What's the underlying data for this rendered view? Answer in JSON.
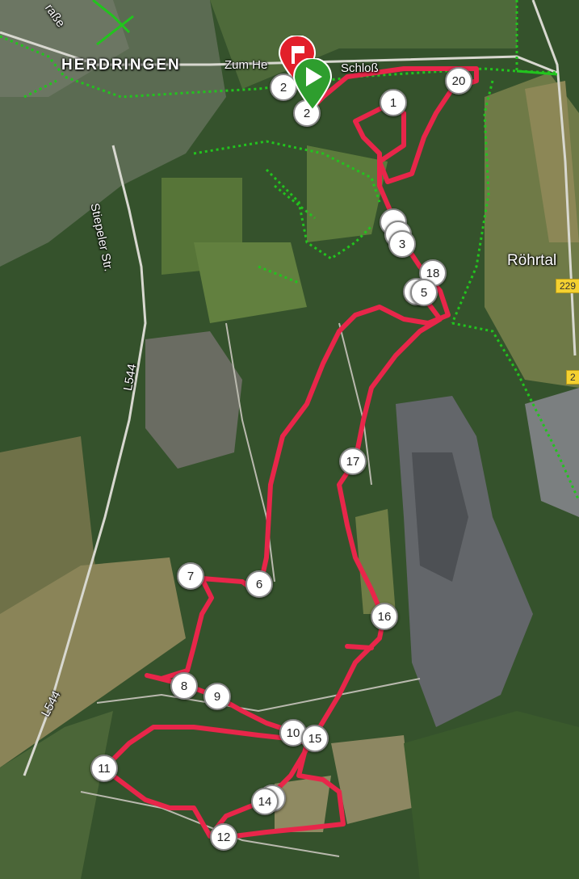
{
  "labels": {
    "town": "HERDRINGEN",
    "street_north": "Zum He",
    "street_east": "Schloß",
    "street_top": "raße",
    "road_west": "Stiepeler Str.",
    "route_a": "L544",
    "route_b": "L544",
    "region": "Röhrtal",
    "shield_1": "229",
    "shield_2": "2"
  },
  "waypoints": [
    {
      "n": "1"
    },
    {
      "n": "2"
    },
    {
      "n": "2"
    },
    {
      "n": "3"
    },
    {
      "n": "5"
    },
    {
      "n": "6"
    },
    {
      "n": "7"
    },
    {
      "n": "8"
    },
    {
      "n": "9"
    },
    {
      "n": "10"
    },
    {
      "n": "11"
    },
    {
      "n": "12"
    },
    {
      "n": "14"
    },
    {
      "n": "15"
    },
    {
      "n": "16"
    },
    {
      "n": "17"
    },
    {
      "n": "18"
    },
    {
      "n": "20"
    }
  ],
  "colors": {
    "route": "#e8264a",
    "trail": "#22c41e",
    "start_pin": "#2e9e2e",
    "finish_pin": "#e21f2a"
  },
  "icons": {
    "start": "play-icon",
    "finish": "flag-icon"
  }
}
